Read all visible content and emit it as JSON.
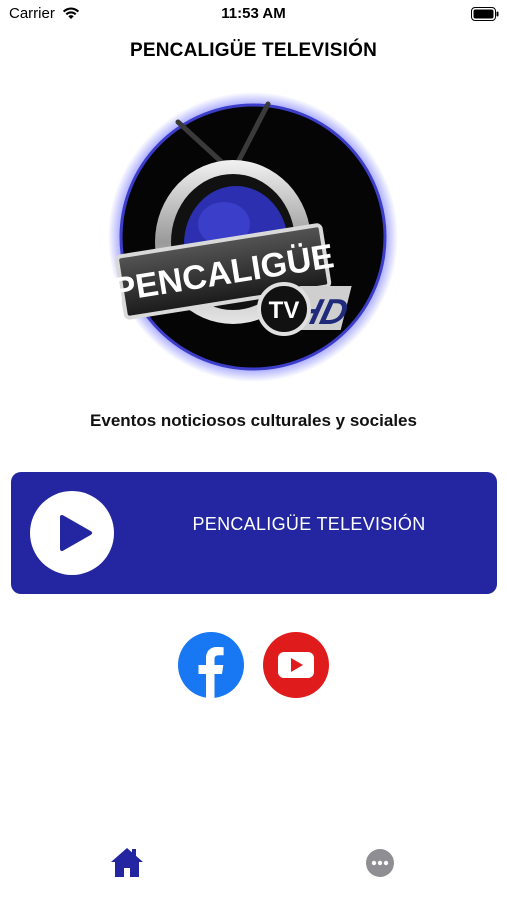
{
  "status_bar": {
    "carrier": "Carrier",
    "time": "11:53 AM"
  },
  "header": {
    "title": "PENCALIGÜE TELEVISIÓN"
  },
  "logo": {
    "brand_text": "PENCALIGÜE",
    "badge_tv": "TV",
    "badge_hd": "HD"
  },
  "tagline": "Eventos noticiosos culturales y sociales",
  "player": {
    "label": "PENCALIGÜE TELEVISIÓN",
    "icon": "play-icon",
    "color": "#2326a0"
  },
  "social": {
    "items": [
      {
        "icon": "facebook-icon",
        "color": "#1877f2"
      },
      {
        "icon": "youtube-icon",
        "color": "#e01b1b"
      }
    ]
  },
  "tab_bar": {
    "items": [
      {
        "icon": "home-icon",
        "color": "#2326a0",
        "selected": true
      },
      {
        "icon": "more-icon",
        "color": "#8e8e93",
        "selected": false
      }
    ]
  }
}
